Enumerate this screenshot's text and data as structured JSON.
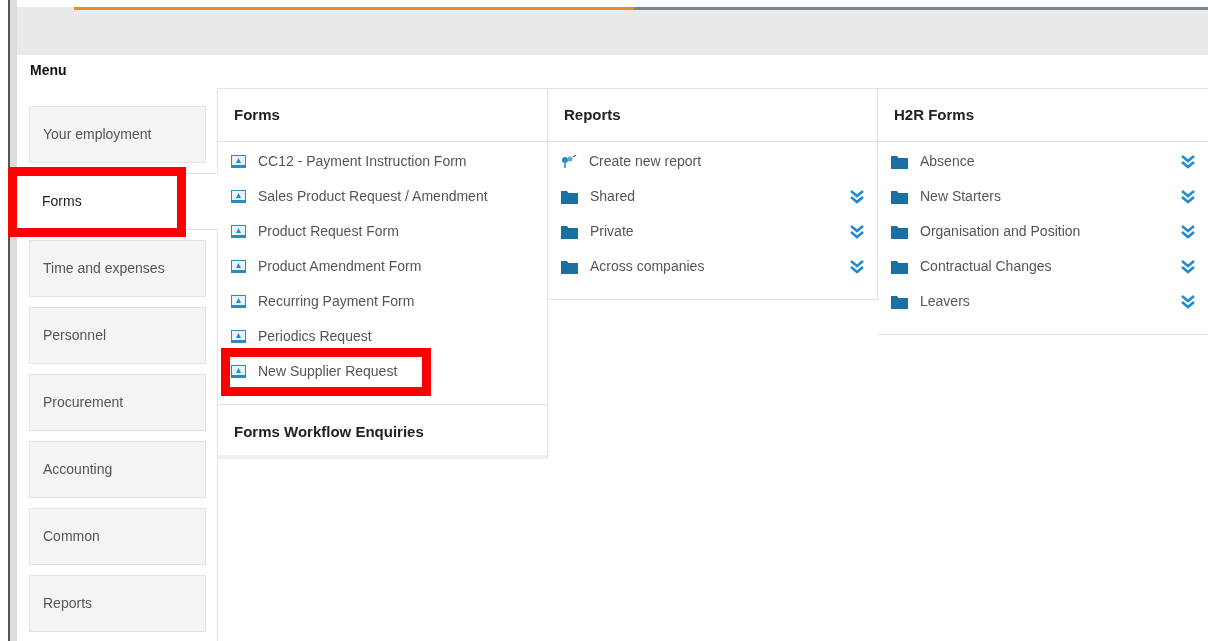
{
  "menu": {
    "title": "Menu"
  },
  "sidebar": {
    "items": [
      {
        "label": "Your employment",
        "selected": false,
        "highlighted": false
      },
      {
        "label": "Forms",
        "selected": true,
        "highlighted": true
      },
      {
        "label": "Time and expenses",
        "selected": false,
        "highlighted": false
      },
      {
        "label": "Personnel",
        "selected": false,
        "highlighted": false
      },
      {
        "label": "Procurement",
        "selected": false,
        "highlighted": false
      },
      {
        "label": "Accounting",
        "selected": false,
        "highlighted": false
      },
      {
        "label": "Common",
        "selected": false,
        "highlighted": false
      },
      {
        "label": "Reports",
        "selected": false,
        "highlighted": false
      }
    ]
  },
  "columns": [
    {
      "title": "Forms",
      "items": [
        {
          "label": "CC12 - Payment Instruction Form",
          "kind": "form",
          "highlighted": false
        },
        {
          "label": "Sales Product Request / Amendment",
          "kind": "form",
          "highlighted": false
        },
        {
          "label": "Product Request Form",
          "kind": "form",
          "highlighted": false
        },
        {
          "label": "Product Amendment Form",
          "kind": "form",
          "highlighted": false
        },
        {
          "label": "Recurring Payment Form",
          "kind": "form",
          "highlighted": false
        },
        {
          "label": "Periodics Request",
          "kind": "form",
          "highlighted": false
        },
        {
          "label": "New Supplier Request",
          "kind": "form",
          "highlighted": true
        }
      ],
      "subsection": {
        "title": "Forms Workflow Enquiries"
      }
    },
    {
      "title": "Reports",
      "items": [
        {
          "label": "Create new report",
          "kind": "action",
          "highlighted": false
        },
        {
          "label": "Shared",
          "kind": "folder",
          "highlighted": false
        },
        {
          "label": "Private",
          "kind": "folder",
          "highlighted": false
        },
        {
          "label": "Across companies",
          "kind": "folder",
          "highlighted": false
        }
      ]
    },
    {
      "title": "H2R Forms",
      "items": [
        {
          "label": "Absence",
          "kind": "folder",
          "highlighted": false
        },
        {
          "label": "New Starters",
          "kind": "folder",
          "highlighted": false
        },
        {
          "label": "Organisation and Position",
          "kind": "folder",
          "highlighted": false
        },
        {
          "label": "Contractual Changes",
          "kind": "folder",
          "highlighted": false
        },
        {
          "label": "Leavers",
          "kind": "folder",
          "highlighted": false
        }
      ]
    }
  ]
}
